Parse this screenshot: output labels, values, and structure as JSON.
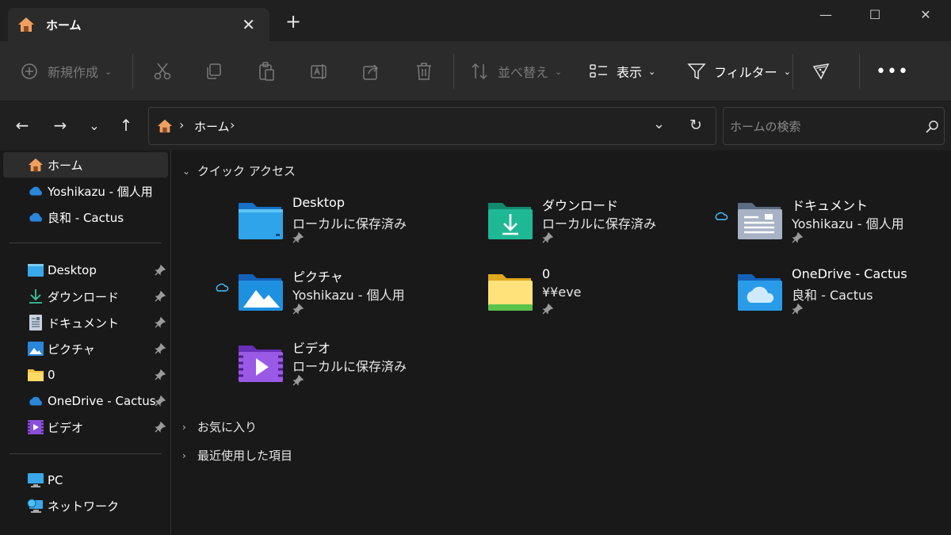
{
  "tab": {
    "title": "ホーム"
  },
  "toolbar": {
    "new_label": "新規作成",
    "sort_label": "並べ替え",
    "view_label": "表示",
    "filter_label": "フィルター"
  },
  "address": {
    "path_label": "ホーム"
  },
  "search": {
    "placeholder": "ホームの検索"
  },
  "sidebar": {
    "top": [
      {
        "label": "ホーム"
      },
      {
        "label": "Yoshikazu - 個人用"
      },
      {
        "label": "良和 - Cactus"
      }
    ],
    "pinned": [
      {
        "label": "Desktop"
      },
      {
        "label": "ダウンロード"
      },
      {
        "label": "ドキュメント"
      },
      {
        "label": "ピクチャ"
      },
      {
        "label": "0"
      },
      {
        "label": "OneDrive - Cactus"
      },
      {
        "label": "ビデオ"
      }
    ],
    "bottom": [
      {
        "label": "PC"
      },
      {
        "label": "ネットワーク"
      }
    ]
  },
  "main": {
    "quick_access_label": "クイック アクセス",
    "favorites_label": "お気に入り",
    "recent_label": "最近使用した項目",
    "tiles": [
      {
        "title": "Desktop",
        "subtitle": "ローカルに保存済み"
      },
      {
        "title": "ダウンロード",
        "subtitle": "ローカルに保存済み"
      },
      {
        "title": "ドキュメント",
        "subtitle": "Yoshikazu - 個人用"
      },
      {
        "title": "ピクチャ",
        "subtitle": "Yoshikazu - 個人用"
      },
      {
        "title": "0",
        "subtitle": "¥¥eve"
      },
      {
        "title": "OneDrive - Cactus",
        "subtitle": "良和 - Cactus"
      },
      {
        "title": "ビデオ",
        "subtitle": "ローカルに保存済み"
      }
    ]
  },
  "colors": {
    "accent": "#4cc2ff",
    "folder_blue": "#1e90e0",
    "folder_yellow": "#f5c542"
  }
}
